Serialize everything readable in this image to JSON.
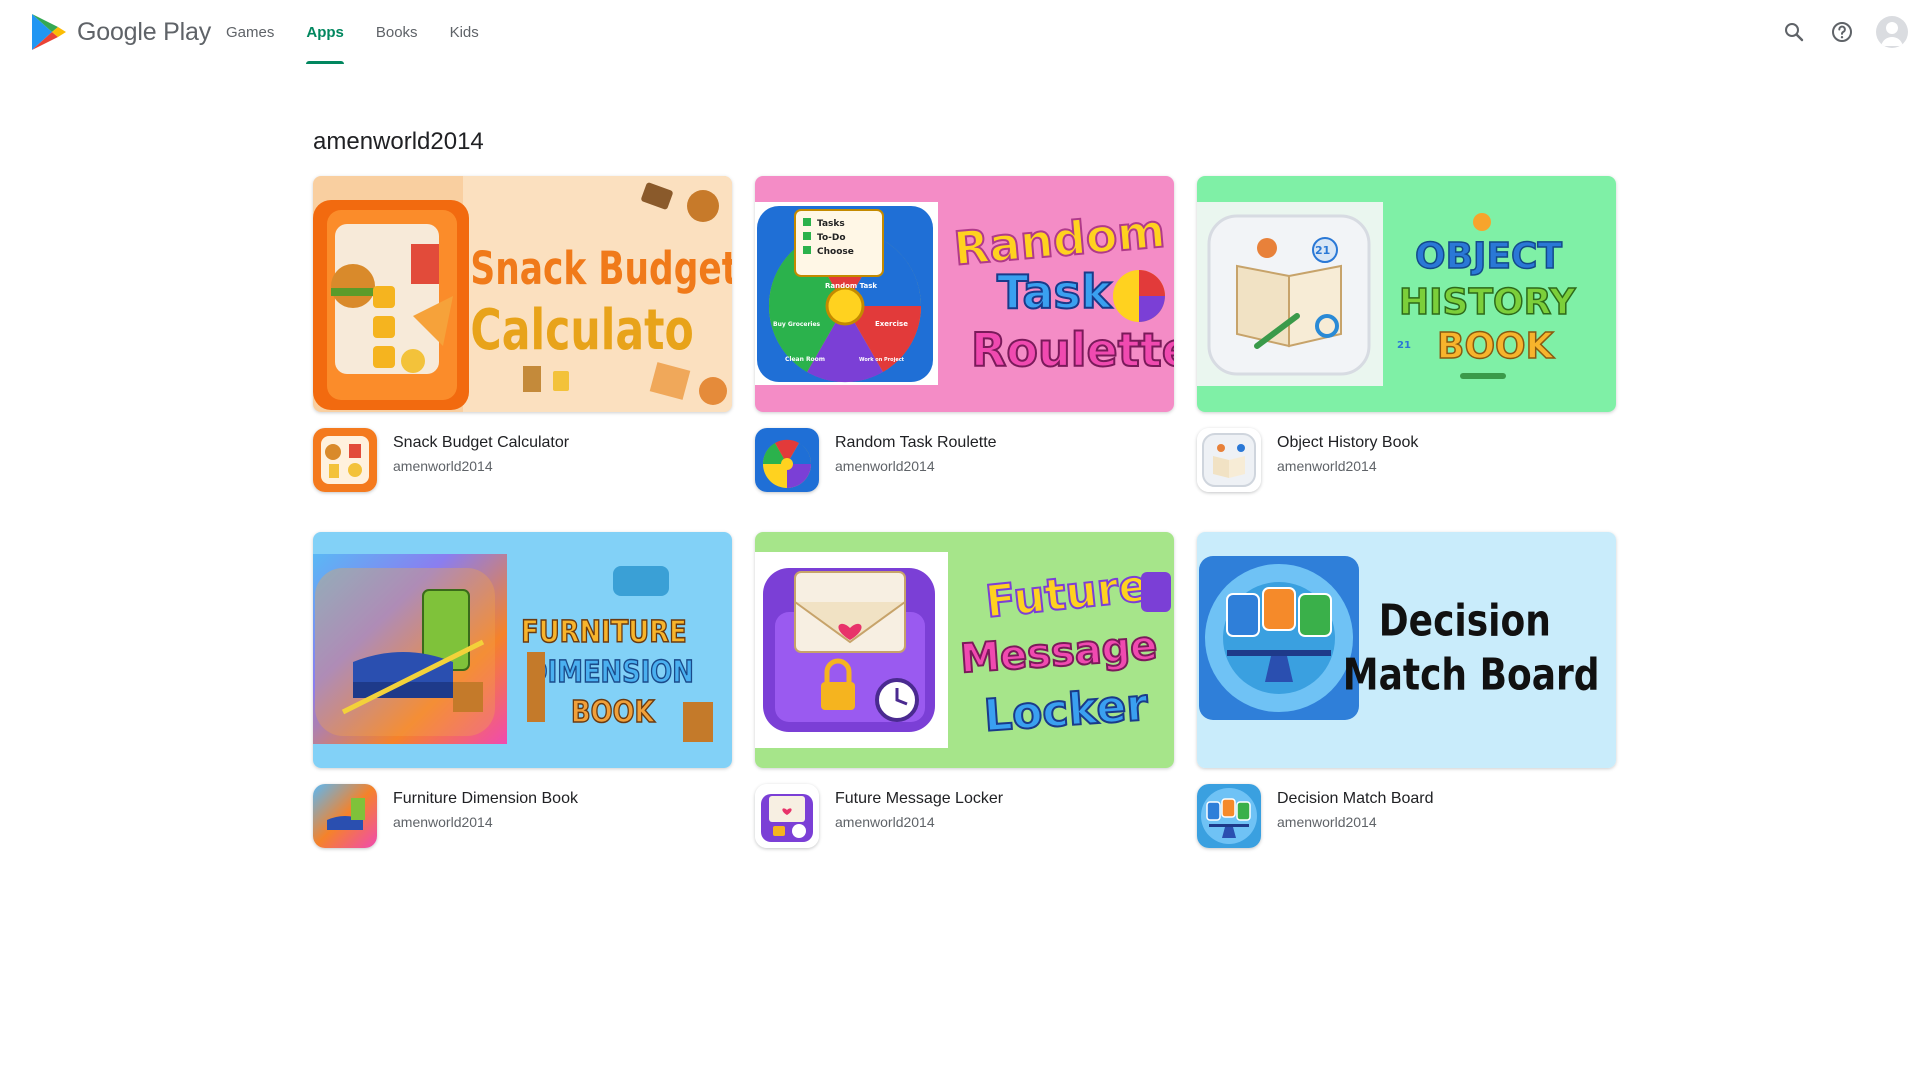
{
  "header": {
    "brand": "Google Play",
    "nav": [
      {
        "label": "Games",
        "active": false
      },
      {
        "label": "Apps",
        "active": true
      },
      {
        "label": "Books",
        "active": false
      },
      {
        "label": "Kids",
        "active": false
      }
    ],
    "icons": [
      "search-icon",
      "help-icon",
      "account-avatar"
    ]
  },
  "page": {
    "developer": "amenworld2014"
  },
  "apps": [
    {
      "name": "Snack Budget Calculator",
      "developer": "amenworld2014",
      "banner_text": [
        "Snack Budget",
        "Calculato"
      ],
      "colors": {
        "bg": "#f7c58c",
        "accent": "#f26a0f",
        "text": "#e8a31a"
      }
    },
    {
      "name": "Random Task Roulette",
      "developer": "amenworld2014",
      "banner_text": [
        "Random",
        "Task",
        "Roulette"
      ],
      "wheel_labels": [
        "Tasks",
        "To-Do",
        "Choose",
        "Random Task",
        "Buy Groceries",
        "Exercise",
        "Clean Room",
        "Work on Project"
      ],
      "colors": {
        "bg": "#f589c4",
        "accent": "#1f6fd6",
        "text": "#ffd21f"
      }
    },
    {
      "name": "Object History Book",
      "developer": "amenworld2014",
      "banner_text": [
        "OBJECT",
        "HISTORY",
        "BOOK"
      ],
      "badges": [
        "21",
        "21"
      ],
      "colors": {
        "bg": "#7ff0a6",
        "accent": "#e9eef5",
        "text": "#2a78d6"
      }
    },
    {
      "name": "Furniture Dimension Book",
      "developer": "amenworld2014",
      "banner_text": [
        "FURNITURE",
        "DIMENSION",
        "BOOK"
      ],
      "colors": {
        "bg": "#7fd0f7",
        "accent": "#f58a2a",
        "text": "#f7b42c"
      }
    },
    {
      "name": "Future Message Locker",
      "developer": "amenworld2014",
      "banner_text": [
        "Future",
        "Message",
        "Locker"
      ],
      "colors": {
        "bg": "#9ce37a",
        "accent": "#7b3fd6",
        "text": "#ffd21f"
      }
    },
    {
      "name": "Decision Match Board",
      "developer": "amenworld2014",
      "banner_text": [
        "Decision",
        "Match Board"
      ],
      "colors": {
        "bg": "#c9ecfb",
        "accent": "#2f7fd9",
        "text": "#111111"
      }
    }
  ]
}
